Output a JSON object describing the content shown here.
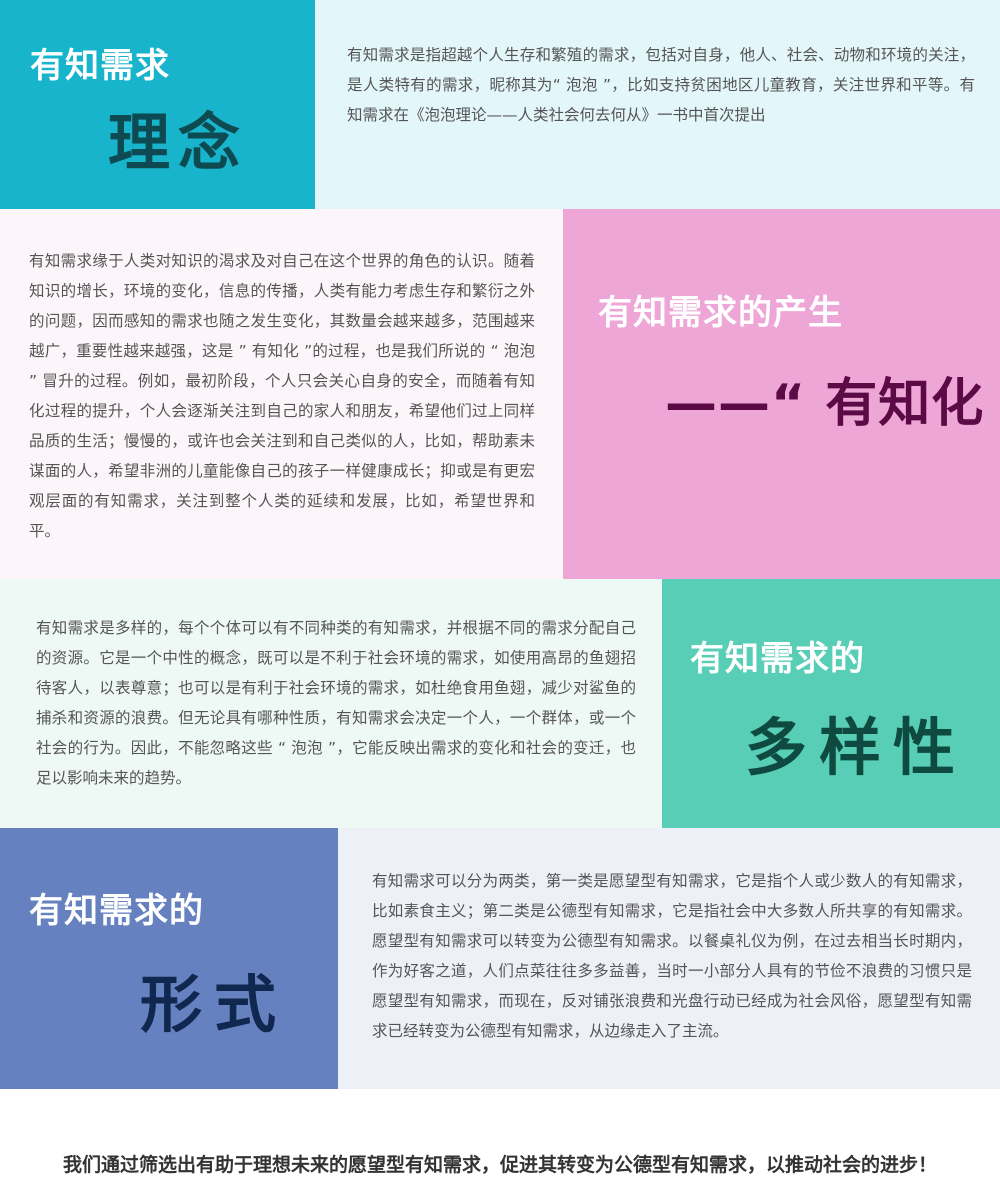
{
  "sections": [
    {
      "heading_small": "有知需求",
      "heading_large": "理念",
      "paragraph": "有知需求是指超越个人生存和繁殖的需求，包括对自身，他人、社会、动物和环境的关注，是人类特有的需求，昵称其为“ 泡泡 ”，比如支持贫困地区儿童教育，关注世界和平等。有知需求在《泡泡理论——人类社会何去何从》一书中首次提出",
      "tile_color": "#18b4cb",
      "background_color": "#e3f6fa",
      "accent_text_color": "#0e4a52"
    },
    {
      "heading_small": "有知需求的产生",
      "heading_large": "——“ 有知化 ”",
      "paragraph": "有知需求缘于人类对知识的渴求及对自己在这个世界的角色的认识。随着知识的增长，环境的变化，信息的传播，人类有能力考虑生存和繁衍之外的问题，因而感知的需求也随之发生变化，其数量会越来越多，范围越来越广，重要性越来越强，这是 ” 有知化 ”的过程，也是我们所说的 “ 泡泡 ” 冒升的过程。例如，最初阶段，个人只会关心自身的安全，而随着有知化过程的提升，个人会逐渐关注到自己的家人和朋友，希望他们过上同样品质的生活；慢慢的，或许也会关注到和自己类似的人，比如，帮助素未谋面的人，希望非洲的儿童能像自己的孩子一样健康成长；抑或是有更宏观层面的有知需求，关注到整个人类的延续和发展，比如，希望世界和平。",
      "tile_color": "#eea6d7",
      "background_color": "#fcf5f9",
      "accent_text_color": "#5c0a45"
    },
    {
      "heading_small": "有知需求的",
      "heading_large": "多样性",
      "paragraph": "有知需求是多样的，每个个体可以有不同种类的有知需求，并根据不同的需求分配自己的资源。它是一个中性的概念，既可以是不利于社会环境的需求，如使用高昂的鱼翅招待客人，以表尊意；也可以是有利于社会环境的需求，如杜绝食用鱼翅，减少对鲨鱼的捕杀和资源的浪费。但无论具有哪种性质，有知需求会决定一个人，一个群体，或一个社会的行为。因此，不能忽略这些 “ 泡泡 ”，它能反映出需求的变化和社会的变迁，也足以影响未来的趋势。",
      "tile_color": "#57ceb5",
      "background_color": "#eef8f5",
      "accent_text_color": "#0e4a40"
    },
    {
      "heading_small": "有知需求的",
      "heading_large": "形式",
      "paragraph": "有知需求可以分为两类，第一类是愿望型有知需求，它是指个人或少数人的有知需求，比如素食主义；第二类是公德型有知需求，它是指社会中大多数人所共享的有知需求。愿望型有知需求可以转变为公德型有知需求。以餐桌礼仪为例，在过去相当长时期内，作为好客之道，人们点菜往往多多益善，当时一小部分人具有的节俭不浪费的习惯只是愿望型有知需求，而现在，反对铺张浪费和光盘行动已经成为社会风俗，愿望型有知需求已经转变为公德型有知需求，从边缘走入了主流。",
      "tile_color": "#6681bf",
      "background_color": "#eef0f8",
      "accent_text_color": "#102850"
    }
  ],
  "closing": "我们通过筛选出有助于理想未来的愿望型有知需求，促进其转变为公德型有知需求，以推动社会的进步！"
}
